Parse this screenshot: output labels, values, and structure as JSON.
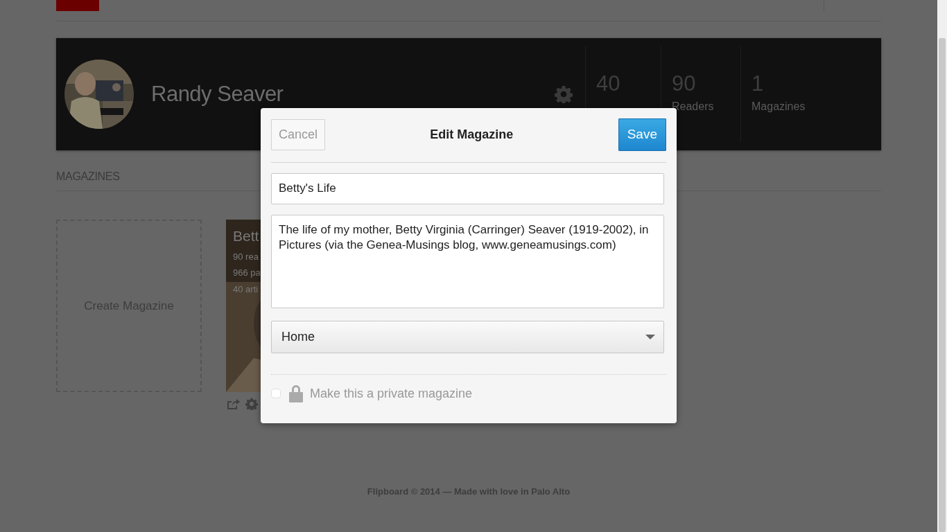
{
  "profile": {
    "name": "Randy Seaver",
    "stats": [
      {
        "value": "40"
      },
      {
        "value": "90",
        "label": "Readers"
      },
      {
        "value": "1",
        "label": "Magazines"
      }
    ]
  },
  "section_title": "MAGAZINES",
  "create_tile": {
    "label": "Create Magazine"
  },
  "magazine_card": {
    "title": "Bett",
    "lines": [
      "90 rea",
      "966 pa",
      "40 arti"
    ]
  },
  "dialog": {
    "title": "Edit Magazine",
    "cancel": "Cancel",
    "save": "Save",
    "name_field": {
      "value": "Betty's Life"
    },
    "description_field": {
      "value": "The life of my mother, Betty Virginia (Carringer) Seaver (1919-2002), in Pictures (via the Genea-Musings blog, www.geneamusings.com)"
    },
    "category": {
      "value": "Home"
    },
    "private": {
      "label": "Make this a private magazine",
      "checked": false
    }
  },
  "footer": "Flipboard © 2014 — Made with love in Palo Alto"
}
